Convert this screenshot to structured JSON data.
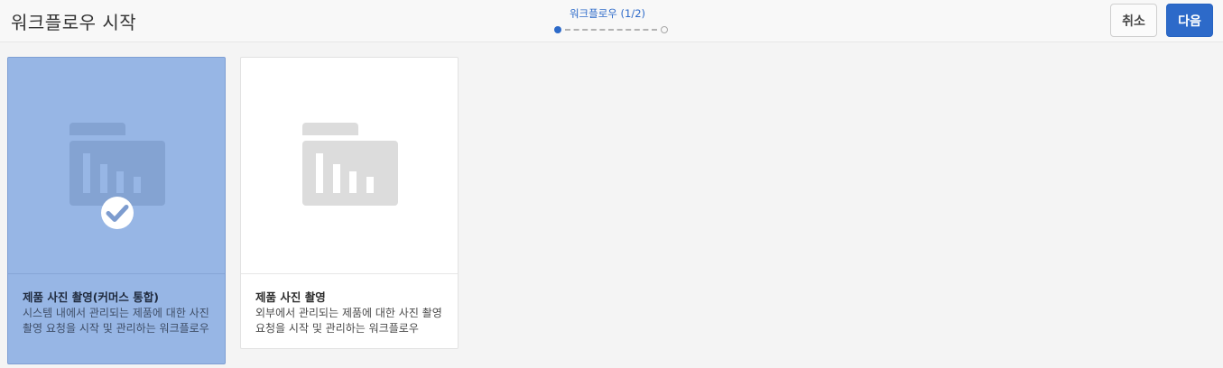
{
  "header": {
    "title": "워크플로우 시작",
    "step_label": "워크플로우 (1/2)",
    "cancel_label": "취소",
    "next_label": "다음"
  },
  "colors": {
    "accent": "#2d6ac9",
    "selected_card": "#97b6e5",
    "background": "#f4f4f4"
  },
  "cards": [
    {
      "title": "제품 사진 촬영(커머스 통합)",
      "description": "시스템 내에서 관리되는 제품에 대한 사진 촬영 요청을 시작 및 관리하는 워크플로우",
      "icon": "folder-chart-icon",
      "selected": true
    },
    {
      "title": "제품 사진 촬영",
      "description": "외부에서 관리되는 제품에 대한 사진 촬영 요청을 시작 및 관리하는 워크플로우",
      "icon": "folder-chart-icon",
      "selected": false
    }
  ]
}
